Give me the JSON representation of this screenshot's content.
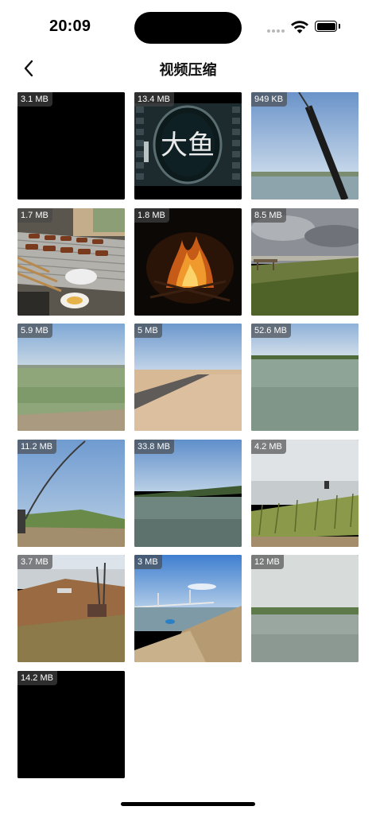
{
  "status_bar": {
    "time": "20:09",
    "wifi_icon": "wifi-icon",
    "battery_icon": "battery-icon"
  },
  "nav": {
    "title": "视频压缩",
    "back_icon": "chevron-left-icon"
  },
  "videos": [
    {
      "size": "3.1 MB",
      "scene": "black"
    },
    {
      "size": "13.4 MB",
      "scene": "film-title",
      "overlay_text": "大鱼"
    },
    {
      "size": "949 KB",
      "scene": "fishing-rod-lake"
    },
    {
      "size": "1.7 MB",
      "scene": "barbecue-grill"
    },
    {
      "size": "1.8 MB",
      "scene": "campfire-night"
    },
    {
      "size": "8.5 MB",
      "scene": "cloudy-grassland"
    },
    {
      "size": "5.9 MB",
      "scene": "green-lake"
    },
    {
      "size": "5 MB",
      "scene": "sandy-road"
    },
    {
      "size": "52.6 MB",
      "scene": "calm-lake"
    },
    {
      "size": "11.2 MB",
      "scene": "fishing-rod-shore"
    },
    {
      "size": "33.8 MB",
      "scene": "lake-treeline"
    },
    {
      "size": "4.2 MB",
      "scene": "reeds-shore"
    },
    {
      "size": "3.7 MB",
      "scene": "muddy-shore"
    },
    {
      "size": "3 MB",
      "scene": "bridge-shore"
    },
    {
      "size": "12 MB",
      "scene": "grey-lake"
    },
    {
      "size": "14.2 MB",
      "scene": "black"
    }
  ]
}
